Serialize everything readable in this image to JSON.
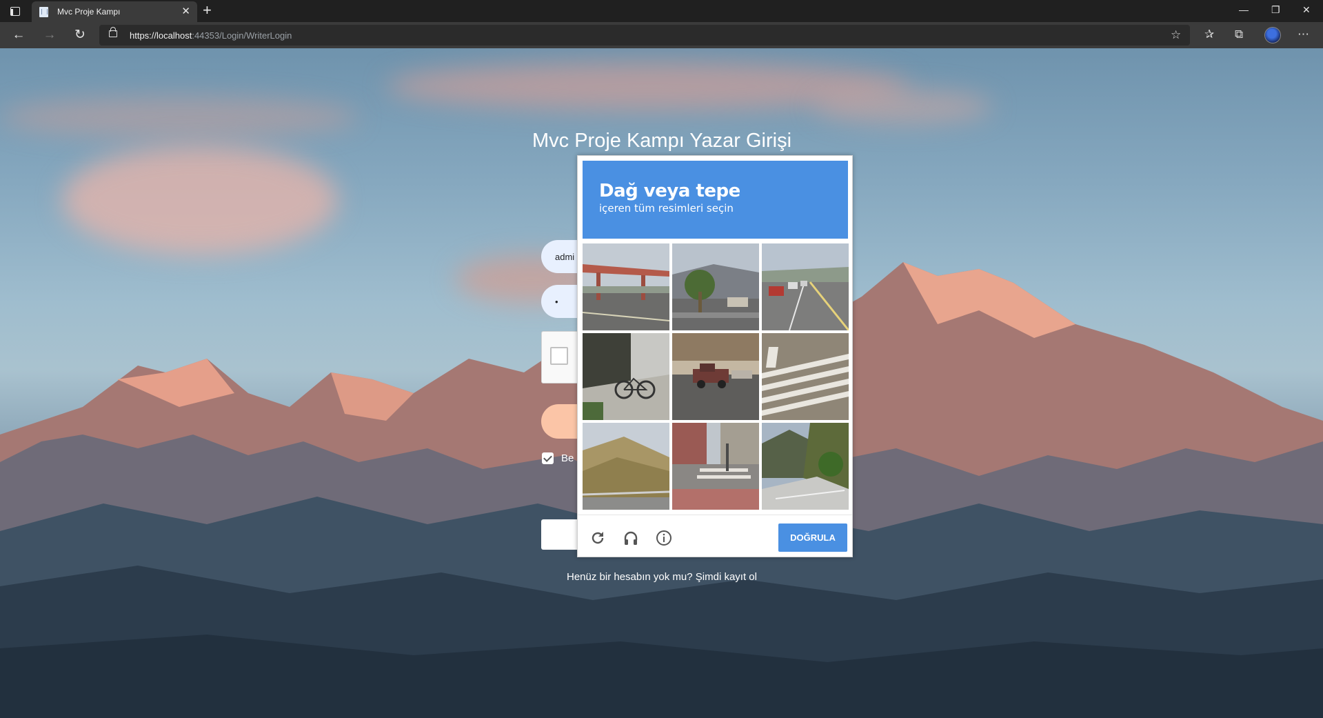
{
  "browser": {
    "tab_title": "Mvc Proje Kampı",
    "tab_close": "✕",
    "new_tab": "+",
    "url_prefix": "https://",
    "url_host": "localhost",
    "url_rest": ":44353/Login/WriterLogin",
    "window_controls": {
      "minimize": "—",
      "restore": "❐",
      "close": "✕"
    },
    "nav": {
      "back": "←",
      "forward": "→",
      "refresh": "↻"
    },
    "toolbar_icons": {
      "favorite": "☆",
      "favorites": "✰",
      "collections": "⧉",
      "more": "⋯"
    }
  },
  "login": {
    "title": "Mvc Proje Kampı Yazar Girişi",
    "username_value": "admi",
    "password_value": "•",
    "remember_label": "Be",
    "signup_text": "Henüz bir hesabın yok mu? ",
    "signup_link": "Şimdi kayıt ol"
  },
  "captcha": {
    "title": "Dağ veya tepe",
    "subtitle": "içeren tüm resimleri seçin",
    "verify_label": "DOĞRULA",
    "header_color": "#4a90e2",
    "icons": [
      "refresh-icon",
      "headphones-icon",
      "info-icon"
    ],
    "tiles": [
      "bridge-overpass",
      "palm-tree-street",
      "traffic-road",
      "bicycle-sidewalk",
      "parked-truck-street",
      "crosswalk",
      "grassy-hill",
      "city-street-crosswalk",
      "hillside-road"
    ]
  }
}
